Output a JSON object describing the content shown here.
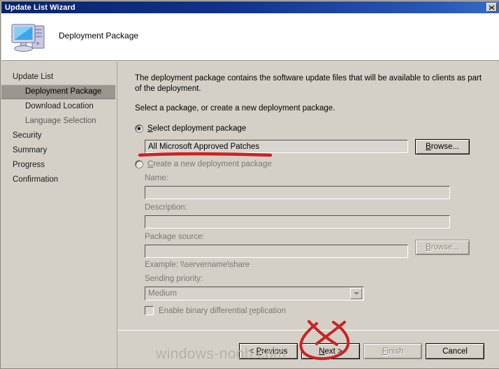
{
  "window": {
    "title": "Update List Wizard",
    "close_label": "✕"
  },
  "header": {
    "title": "Deployment Package",
    "icon": "computer-icon"
  },
  "sidebar": {
    "items": [
      {
        "label": "Update List",
        "indent": false,
        "state": "normal"
      },
      {
        "label": "Deployment Package",
        "indent": true,
        "state": "selected"
      },
      {
        "label": "Download Location",
        "indent": true,
        "state": "normal"
      },
      {
        "label": "Language Selection",
        "indent": true,
        "state": "dim"
      },
      {
        "label": "Security",
        "indent": false,
        "state": "normal"
      },
      {
        "label": "Summary",
        "indent": false,
        "state": "normal"
      },
      {
        "label": "Progress",
        "indent": false,
        "state": "normal"
      },
      {
        "label": "Confirmation",
        "indent": false,
        "state": "normal"
      }
    ]
  },
  "content": {
    "intro": "The deployment package contains the software update files that will be available to clients as part of the deployment.",
    "instruction": "Select a package, or create a new deployment package.",
    "select_radio": {
      "label": "Select deployment package",
      "accel": "S",
      "checked": true
    },
    "package_value": "All Microsoft Approved Patches",
    "browse_1": "Browse...",
    "create_radio": {
      "label": "Create a new deployment package",
      "accel": "C",
      "checked": false
    },
    "name_label": "Name:",
    "name_value": "",
    "description_label": "Description:",
    "description_value": "",
    "package_source_label": "Package source:",
    "package_source_value": "",
    "browse_2": "Browse...",
    "example_text": "Example: \\\\servername\\share",
    "sending_priority_label": "Sending priority:",
    "sending_priority_value": "Medium",
    "binary_replication_label": "Enable binary differential replication",
    "binary_replication_checked": false
  },
  "footer": {
    "previous": "< Previous",
    "next": "Next >",
    "finish": "Finish",
    "cancel": "Cancel",
    "finish_disabled": true
  },
  "watermark": "windows-noob.com",
  "annotation": {
    "color": "#cc2222",
    "underline_target": "package_value",
    "circle_target": "next-button"
  }
}
